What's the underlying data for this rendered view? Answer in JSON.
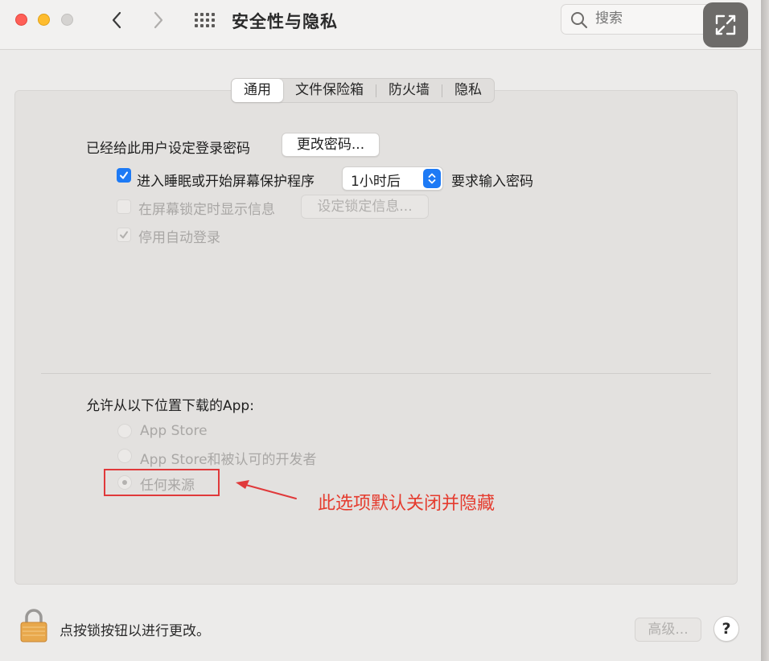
{
  "window": {
    "title": "安全性与隐私"
  },
  "search": {
    "placeholder": "搜索"
  },
  "tabs": [
    {
      "label": "通用",
      "active": true
    },
    {
      "label": "文件保险箱",
      "active": false
    },
    {
      "label": "防火墙",
      "active": false
    },
    {
      "label": "隐私",
      "active": false
    }
  ],
  "general": {
    "password_set_label": "已经给此用户设定登录密码",
    "change_password_button": "更改密码...",
    "require_password": {
      "checked": true,
      "label_before": "进入睡眠或开始屏幕保护程序",
      "delay_value": "1小时后",
      "label_after": "要求输入密码"
    },
    "show_message": {
      "checked": false,
      "enabled": false,
      "label": "在屏幕锁定时显示信息",
      "button": "设定锁定信息..."
    },
    "disable_auto_login": {
      "checked": true,
      "enabled": false,
      "label": "停用自动登录"
    }
  },
  "downloads": {
    "heading": "允许从以下位置下载的App:",
    "options": [
      {
        "label": "App Store",
        "selected": false
      },
      {
        "label": "App Store和被认可的开发者",
        "selected": false
      },
      {
        "label": "任何来源",
        "selected": true
      }
    ]
  },
  "annotation": {
    "text": "此选项默认关闭并隐藏",
    "color": "#e53b2e"
  },
  "footer": {
    "lock_text": "点按锁按钮以进行更改。",
    "advanced_button": "高级...",
    "help_button": "?"
  },
  "colors": {
    "accent": "#1d7af5",
    "annotation_red": "#e0393a"
  }
}
